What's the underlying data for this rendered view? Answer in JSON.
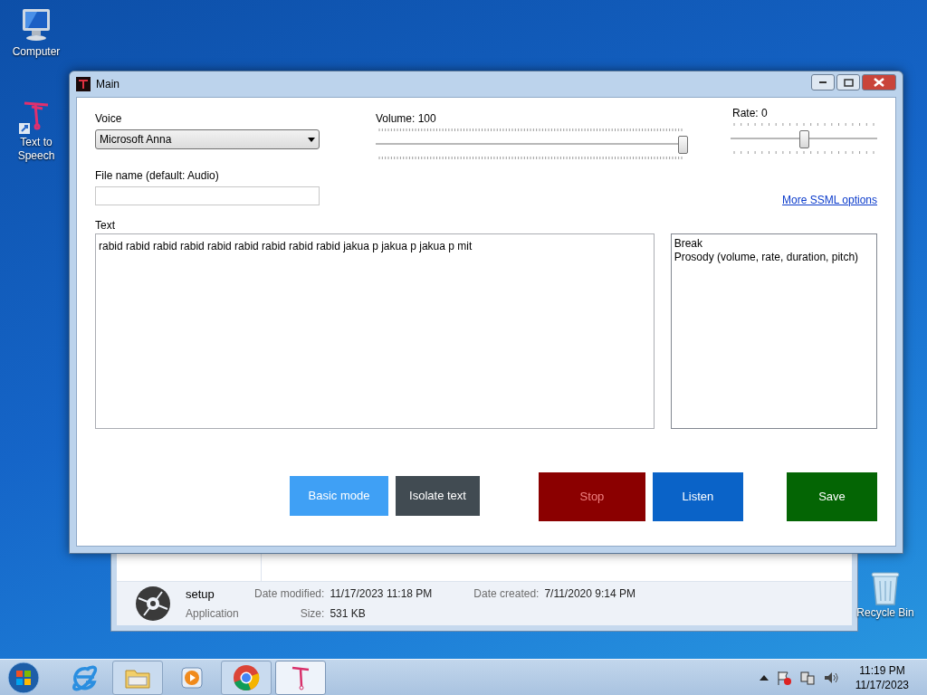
{
  "desktop_icons": [
    {
      "kind": "computer",
      "label": "Computer"
    },
    {
      "kind": "app",
      "label": "Text to Speech"
    },
    {
      "kind": "recycle",
      "label": "Recycle Bin"
    }
  ],
  "background_window": {
    "file_name": "setup",
    "file_type": "Application",
    "date_modified_label": "Date modified:",
    "date_modified": "11/17/2023 11:18 PM",
    "date_created_label": "Date created:",
    "date_created": "7/11/2020 9:14 PM",
    "size_label": "Size:",
    "size": "531 KB"
  },
  "window": {
    "title": "Main"
  },
  "voice": {
    "label": "Voice",
    "value": "Microsoft Anna"
  },
  "volume": {
    "label": "Volume: 100",
    "level": 1.0
  },
  "rate": {
    "label": "Rate: 0",
    "level": 0.5
  },
  "file_name": {
    "label": "File name (default: Audio)"
  },
  "ssml_link": "More SSML options",
  "text": {
    "label": "Text",
    "value": "rabid rabid rabid rabid rabid rabid rabid rabid rabid jakua p jakua p jakua p mit"
  },
  "ssml_options": [
    "Break",
    "Prosody (volume, rate, duration, pitch)"
  ],
  "buttons": [
    {
      "kind": "basic",
      "label": "Basic mode"
    },
    {
      "kind": "isolate",
      "label": "Isolate text"
    },
    {
      "kind": "stop",
      "label": "Stop"
    },
    {
      "kind": "listen",
      "label": "Listen"
    },
    {
      "kind": "save",
      "label": "Save"
    }
  ],
  "taskbar": {
    "items": [
      {
        "kind": "ie",
        "open": false
      },
      {
        "kind": "explorer",
        "open": true
      },
      {
        "kind": "media",
        "open": false
      },
      {
        "kind": "chrome",
        "open": true
      },
      {
        "kind": "tts",
        "open": true,
        "selected": true
      }
    ],
    "time": "11:19 PM",
    "date": "11/17/2023"
  }
}
